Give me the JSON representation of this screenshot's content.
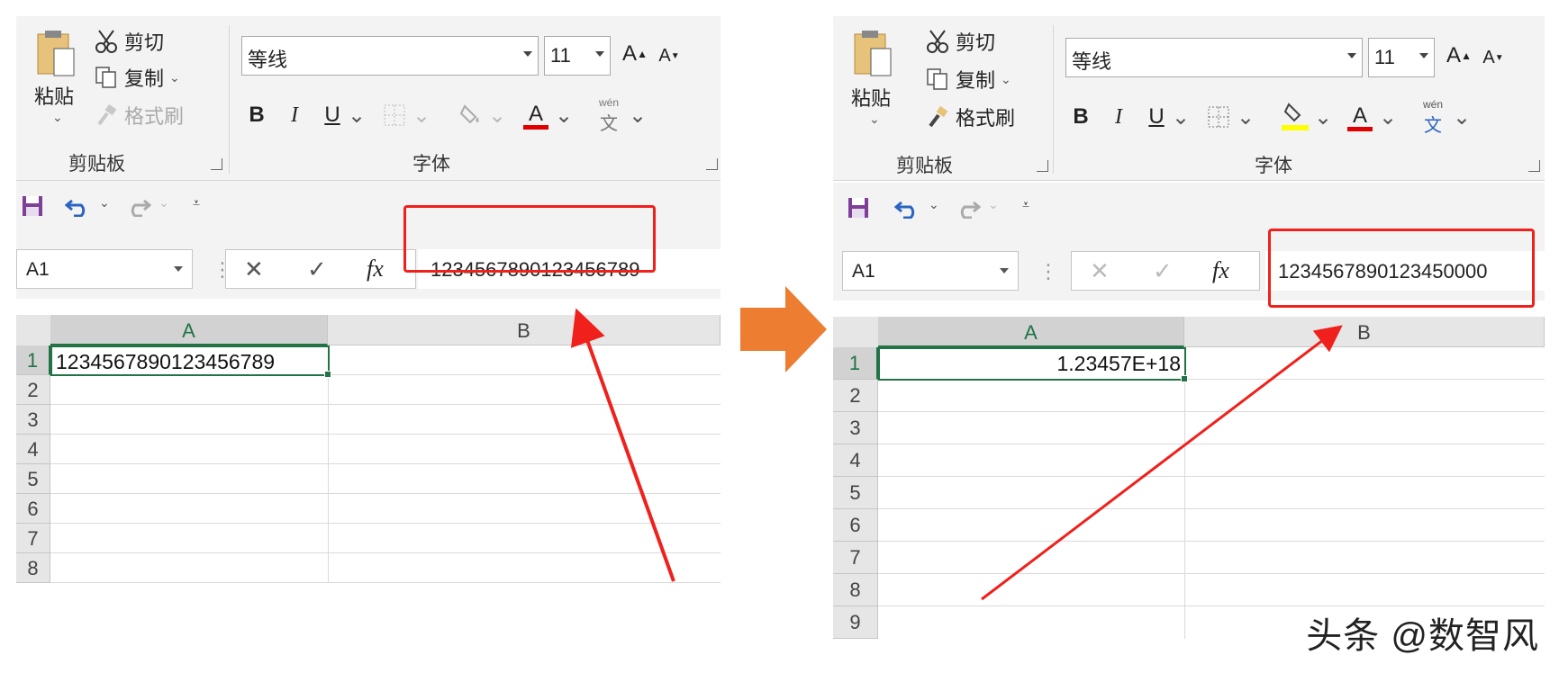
{
  "ribbon": {
    "paste_label": "粘贴",
    "cut_label": "剪切",
    "copy_label": "复制",
    "format_painter_label": "格式刷",
    "clipboard_group": "剪贴板",
    "font_group": "字体",
    "font_name": "等线",
    "font_size": "11",
    "bold": "B",
    "italic": "I",
    "underline": "U",
    "font_color_letter": "A",
    "phonetic_top": "wén",
    "phonetic_bottom": "文",
    "grow_font": "A",
    "shrink_font": "A"
  },
  "left": {
    "name_box": "A1",
    "formula_value": "123456789012345678 9",
    "cell_a1": "1234567890123456789",
    "columns": [
      "A",
      "B"
    ],
    "rows": [
      "1",
      "2",
      "3",
      "4",
      "5",
      "6",
      "7",
      "8"
    ]
  },
  "right": {
    "name_box": "A1",
    "formula_value": "123456789012345000 0",
    "cell_a1": "1.23457E+18",
    "columns": [
      "A",
      "B"
    ],
    "rows": [
      "1",
      "2",
      "3",
      "4",
      "5",
      "6",
      "7",
      "8",
      "9"
    ]
  },
  "formula_icons": {
    "cancel": "✕",
    "enter": "✓",
    "fx": "fx"
  },
  "watermark": "头条 @数智风",
  "colors": {
    "accent_green": "#217346",
    "annotation_red": "#f0201c",
    "arrow_orange": "#ed7d31",
    "font_color_bar": "#e00000",
    "highlight_bar": "#ffff00"
  }
}
